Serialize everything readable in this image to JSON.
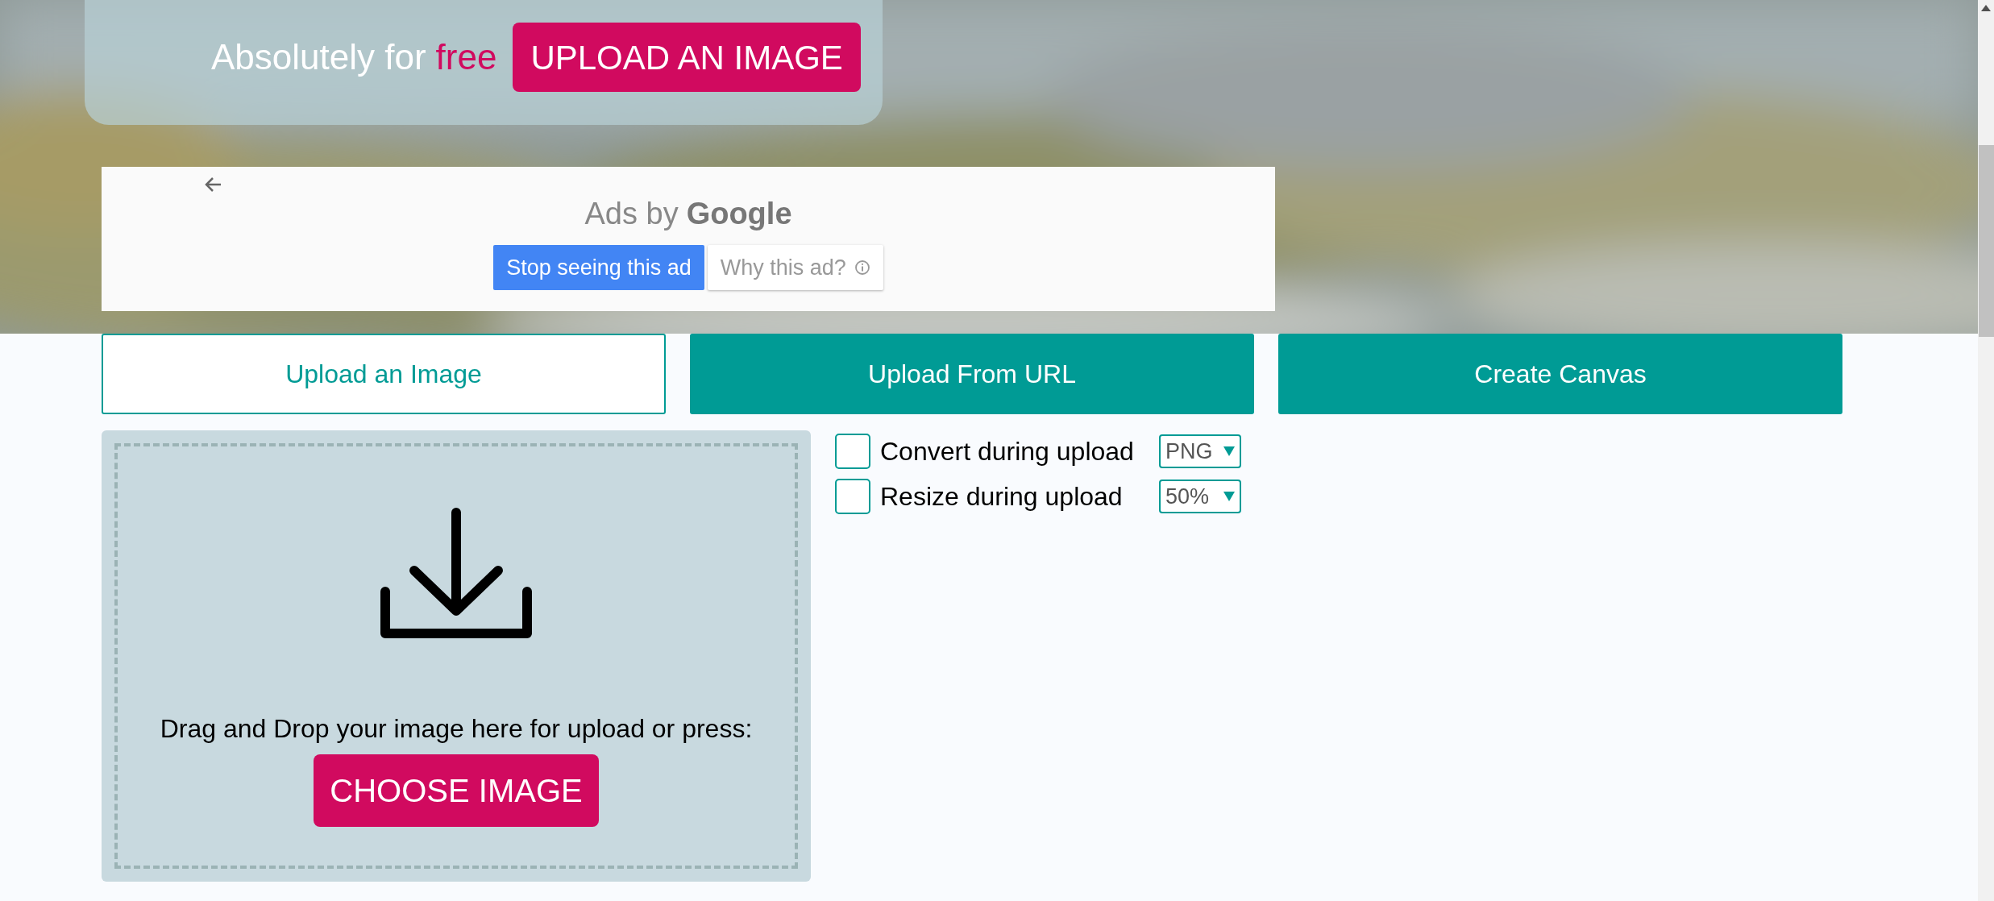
{
  "hero": {
    "tagline": "Absolutely for",
    "highlight": "free",
    "upload_button": "UPLOAD AN IMAGE"
  },
  "ad": {
    "label": "Ads by",
    "brand": "Google",
    "stop_button": "Stop seeing this ad",
    "why_button": "Why this ad?"
  },
  "tabs": [
    {
      "label": "Upload an Image",
      "selected": true
    },
    {
      "label": "Upload From URL",
      "selected": false
    },
    {
      "label": "Create Canvas",
      "selected": false
    }
  ],
  "dropzone": {
    "instruction": "Drag and Drop your image here for upload or press:",
    "button": "CHOOSE IMAGE"
  },
  "options": [
    {
      "label": "Convert during upload",
      "checked": false,
      "value": "PNG"
    },
    {
      "label": "Resize during upload",
      "checked": false,
      "value": "50%"
    }
  ]
}
